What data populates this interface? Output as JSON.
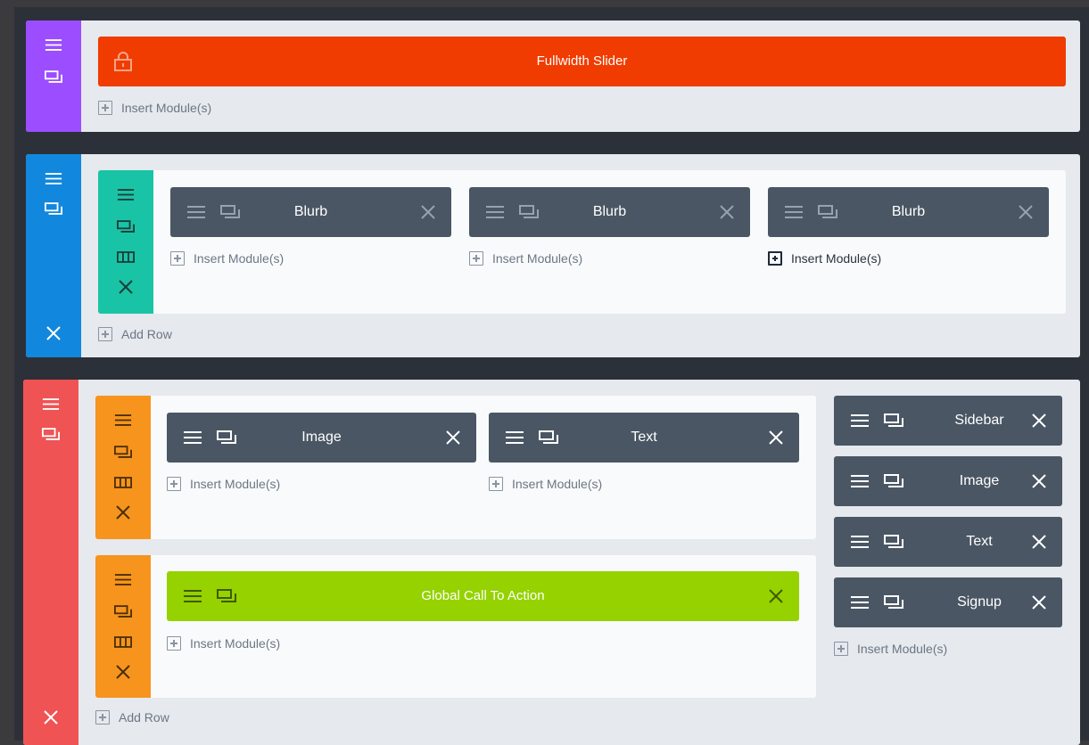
{
  "colors": {
    "fullwidth_section": "#9b4dff",
    "regular_section": "#1188dd",
    "specialty_section": "#f05353",
    "row_teal": "#19c4a6",
    "row_orange": "#f7941d",
    "module_dark": "#4a5664",
    "fullwidth_module": "#f03c00",
    "global_module": "#95d200",
    "page_bg": "#2c3038",
    "section_bg": "#e6e9ed"
  },
  "sections": {
    "fullwidth": {
      "module_label": "Fullwidth Slider",
      "module_icon": "lock-icon",
      "insert_label": "Insert Module(s)"
    },
    "regular": {
      "columns": [
        {
          "module_label": "Blurb",
          "insert_label": "Insert Module(s)"
        },
        {
          "module_label": "Blurb",
          "insert_label": "Insert Module(s)"
        },
        {
          "module_label": "Blurb",
          "insert_label": "Insert Module(s)"
        }
      ],
      "add_row_label": "Add Row"
    },
    "specialty": {
      "row1": {
        "columns": [
          {
            "module_label": "Image",
            "insert_label": "Insert Module(s)"
          },
          {
            "module_label": "Text",
            "insert_label": "Insert Module(s)"
          }
        ]
      },
      "row2": {
        "module_label": "Global Call To Action",
        "insert_label": "Insert Module(s)"
      },
      "sidebar_modules": [
        "Sidebar",
        "Image",
        "Text",
        "Signup"
      ],
      "sidebar_insert_label": "Insert Module(s)",
      "add_row_label": "Add Row"
    }
  }
}
